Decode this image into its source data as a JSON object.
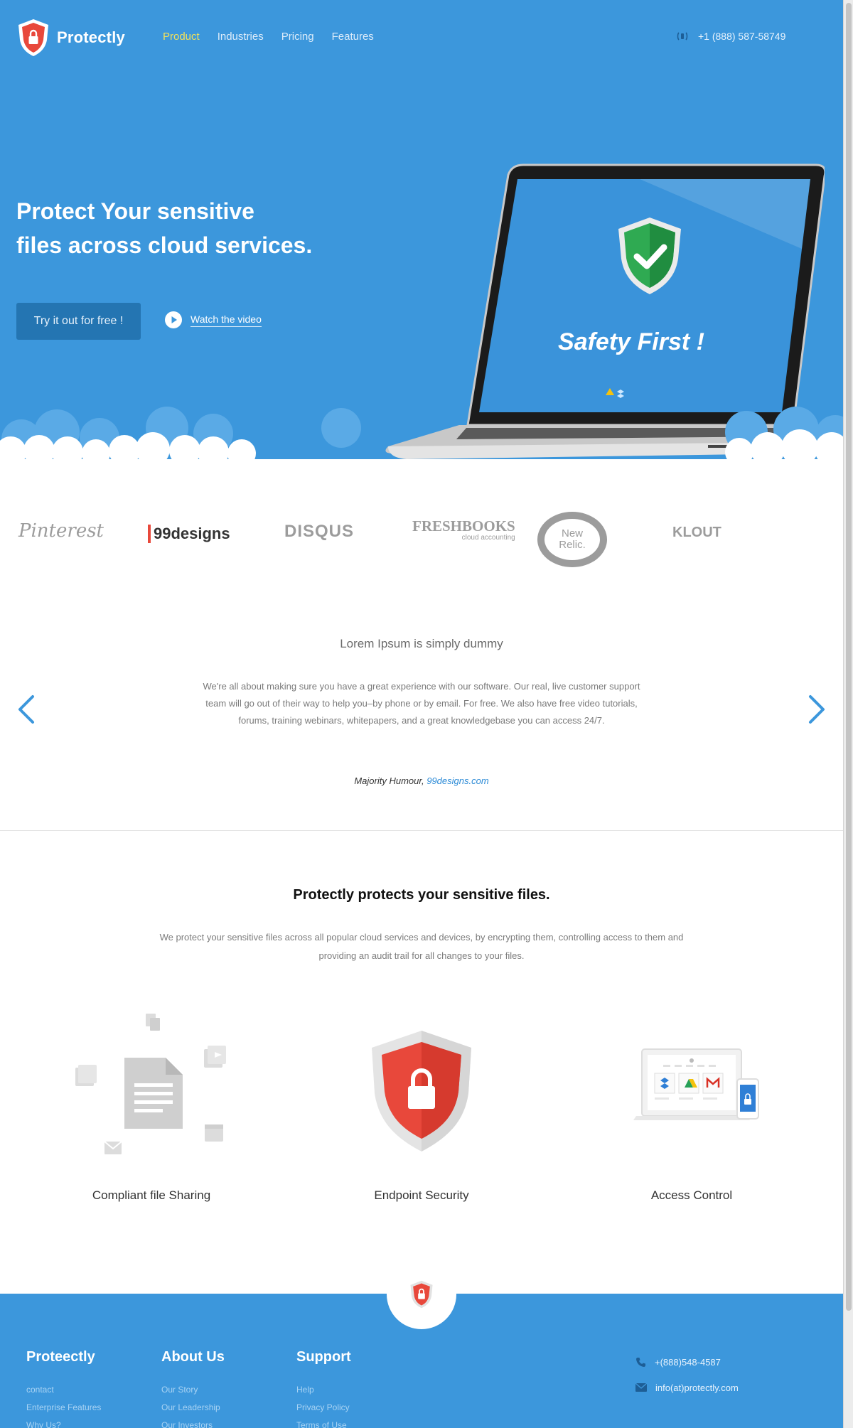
{
  "header": {
    "brand": "Protectly",
    "nav": [
      {
        "label": "Product",
        "active": true
      },
      {
        "label": "Industries",
        "active": false
      },
      {
        "label": "Pricing",
        "active": false
      },
      {
        "label": "Features",
        "active": false
      }
    ],
    "phone": "+1 (888) 587-58749"
  },
  "hero": {
    "title_line1": "Protect Your sensitive",
    "title_line2": "files across cloud services.",
    "cta_label": "Try it out for free !",
    "video_label": "Watch the video",
    "screen_text": "Safety First !"
  },
  "logos": [
    "Pinterest",
    "99designs",
    "DISQUS",
    "FRESHBOOKS",
    "cloud accounting",
    "New Relic.",
    "KLOUT"
  ],
  "testimonial": {
    "title": "Lorem Ipsum is simply dummy",
    "body": "We're all about making sure you have a great experience with our software. Our real, live customer support team will go out of their way to help you–by phone or by email. For free. We also have free video tutorials, forums, training webinars, whitepapers, and a great knowledgebase you can access 24/7.",
    "author": "Majority Humour,",
    "author_link": "99designs.com"
  },
  "features": {
    "title": "Protectly protects your sensitive files.",
    "body": "We protect your sensitive files across all popular cloud services and devices, by encrypting them, controlling access to them and providing an audit trail for all changes to your files.",
    "items": [
      {
        "label": "Compliant file Sharing",
        "icon": "file-sharing-icon"
      },
      {
        "label": "Endpoint Security",
        "icon": "shield-lock-icon"
      },
      {
        "label": "Access Control",
        "icon": "devices-icon"
      }
    ]
  },
  "footer": {
    "columns": [
      {
        "title": "Proteectly",
        "links": [
          "contact",
          "Enterprise Features",
          "Why Us?"
        ]
      },
      {
        "title": "About Us",
        "links": [
          "Our Story",
          "Our Leadership",
          "Our Investors"
        ]
      },
      {
        "title": "Support",
        "links": [
          "Help",
          "Privacy Policy",
          "Terms of Use"
        ]
      }
    ],
    "phone": "+(888)548-4587",
    "email": "info(at)protectly.com"
  },
  "colors": {
    "primary_blue": "#3c97dc",
    "button_blue": "#2475b2",
    "active_nav": "#f1e05a",
    "shield_red": "#e8483b",
    "shield_green": "#2faa52",
    "link_blue": "#2b8ad6"
  }
}
